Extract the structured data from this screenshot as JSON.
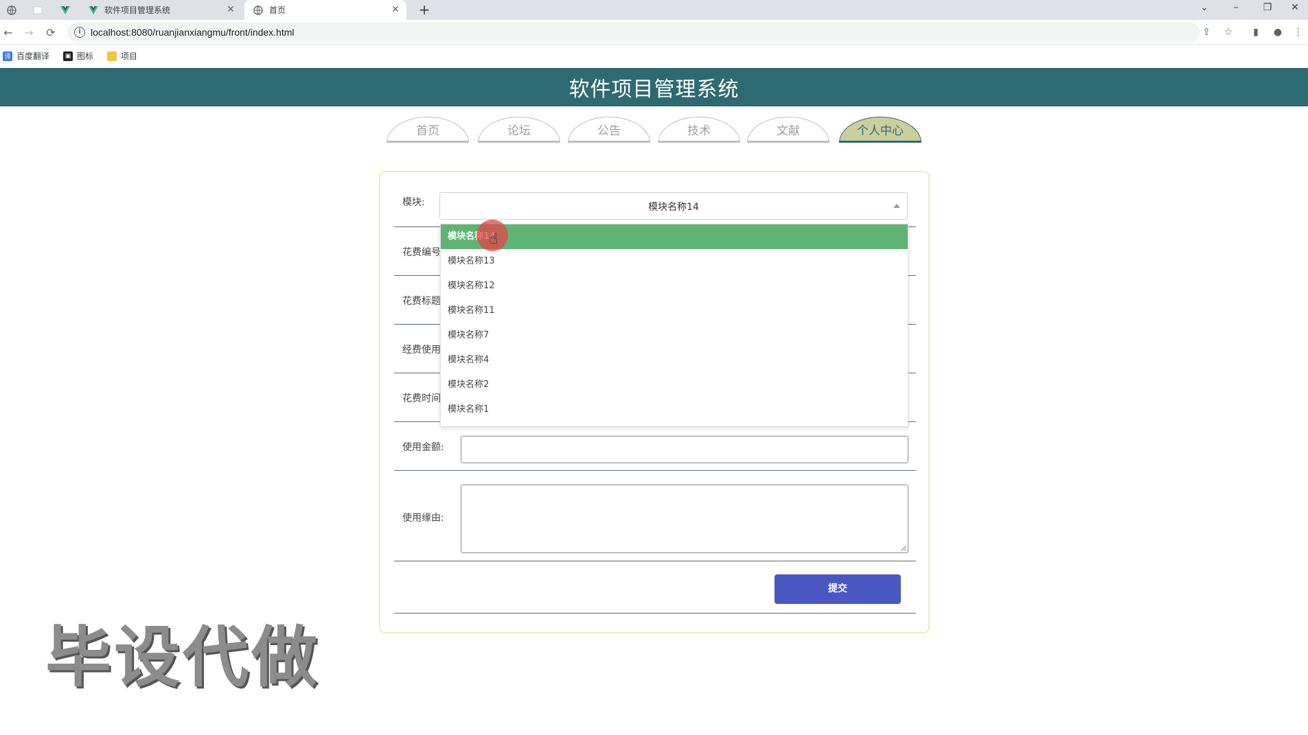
{
  "browser": {
    "tabs": [
      {
        "title": "软件项目管理系统",
        "active": false
      },
      {
        "title": "首页",
        "active": true
      }
    ],
    "url": "localhost:8080/ruanjianxiangmu/front/index.html",
    "bookmarks": [
      "百度翻译",
      "图标",
      "项目"
    ]
  },
  "header": {
    "title": "软件项目管理系统"
  },
  "nav": {
    "items": [
      "首页",
      "论坛",
      "公告",
      "技术",
      "文献",
      "个人中心"
    ],
    "active_index": 5
  },
  "form": {
    "module_label": "模块:",
    "module_value": "模块名称14",
    "cost_no_label": "花费编号",
    "cost_title_label": "花费标题",
    "fund_use_label": "经费使用",
    "cost_time_label": "花费时间",
    "amount_label": "使用金额:",
    "reason_label": "使用缘由:",
    "submit_label": "提交"
  },
  "dropdown": {
    "options": [
      "模块名称14",
      "模块名称13",
      "模块名称12",
      "模块名称11",
      "模块名称7",
      "模块名称4",
      "模块名称2",
      "模块名称1"
    ],
    "highlighted_index": 0
  },
  "watermark": "毕设代做",
  "colors": {
    "header_bg": "#2e6a72",
    "nav_active_bg": "#cbcf9e",
    "option_highlight": "#5fb474",
    "submit_bg": "#4a57c3"
  }
}
